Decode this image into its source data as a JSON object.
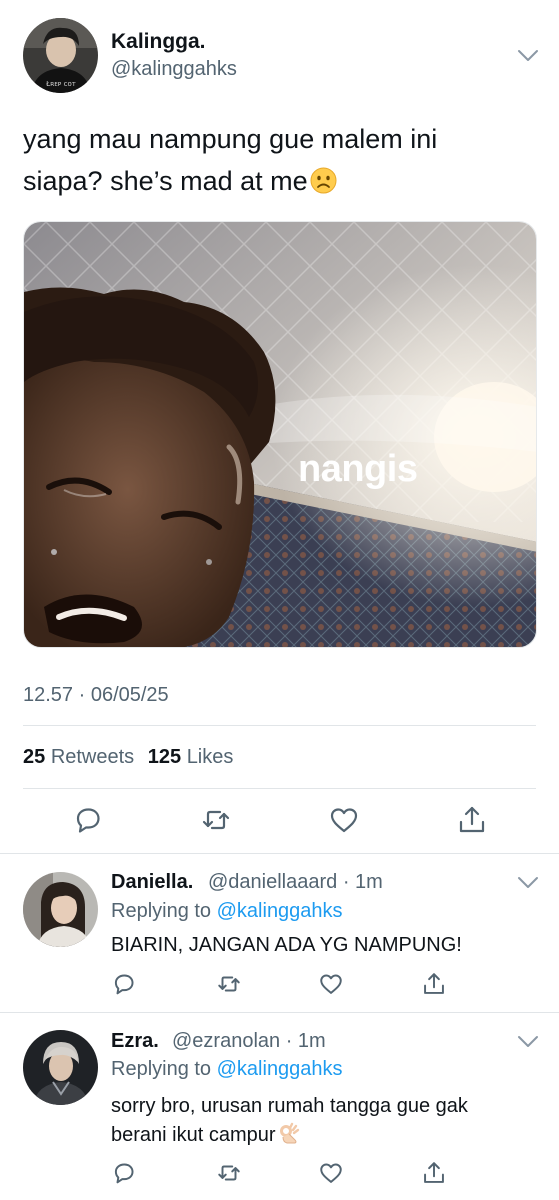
{
  "main_tweet": {
    "author_name": "Kalingga.",
    "author_handle": "@kalinggahks",
    "text_line1": "yang mau nampung gue malem ini",
    "text_line2": "siapa? she’s mad at me",
    "text_emoji": "frowning-face",
    "media_caption": "nangis",
    "timestamp": "12.57 · 06/05/25",
    "retweet_count": "25",
    "retweet_label": "Retweets",
    "like_count": "125",
    "like_label": "Likes"
  },
  "replies": [
    {
      "name": "Daniella.",
      "handle": "@daniellaaard · 1m",
      "replying_prefix": "Replying to",
      "replying_to": "@kalinggahks",
      "text": "BIARIN, JANGAN ADA YG NAMPUNG!"
    },
    {
      "name": "Ezra.",
      "handle": "@ezranolan · 1m",
      "replying_prefix": "Replying to",
      "replying_to": "@kalinggahks",
      "text_line1": "sorry bro, urusan rumah tangga gue gak",
      "text_line2": "berani ikut campur",
      "text_emoji": "ok-hand"
    }
  ],
  "icons": [
    "chevron-down-icon",
    "reply-icon",
    "retweet-icon",
    "like-icon",
    "share-icon"
  ],
  "colors": {
    "text_primary": "#0f1419",
    "text_secondary": "#536471",
    "link": "#1d9bf0",
    "divider": "#e1e5e8"
  }
}
